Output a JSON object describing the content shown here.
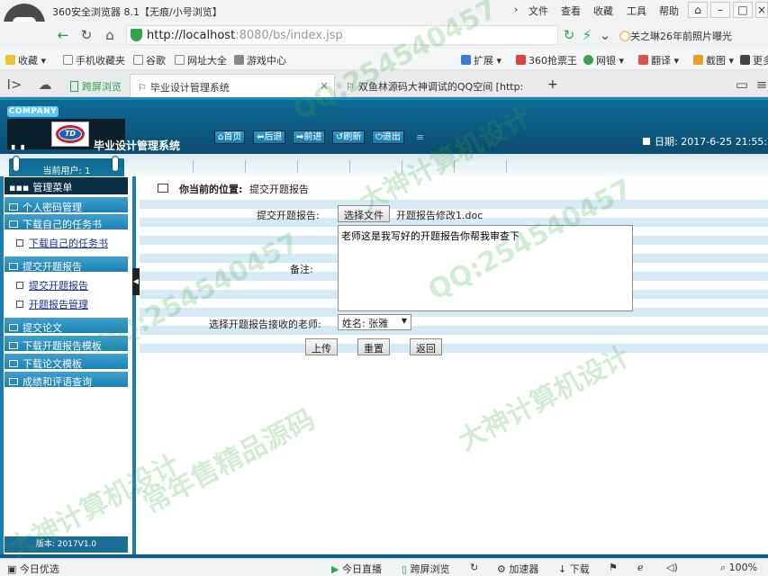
{
  "browser": {
    "title": "360安全浏览器 8.1【无痕/小号浏览】",
    "menu": [
      "文件",
      "查看",
      "收藏",
      "工具",
      "帮助"
    ],
    "url_host": "http://localhost",
    "url_rest": ":8080/bs/index.jsp",
    "search_hint": "关之琳26年前照片曝光",
    "bookmarks": [
      "收藏",
      "手机收藏夹",
      "谷歌",
      "网址大全",
      "游戏中心"
    ],
    "bookmarks_right": [
      "扩展",
      "360抢票王",
      "网银",
      "翻译",
      "截图",
      "更多"
    ],
    "tabs": [
      "跨屏浏览",
      "毕业设计管理系统",
      "双鱼林源码大神调试的QQ空间 [http:"
    ],
    "status_items": [
      "今日优选",
      "今日直播",
      "跨屏浏览",
      "加速器",
      "下载",
      "100%"
    ]
  },
  "header": {
    "company": "COMPANY",
    "logo_text": "TD",
    "system_name": "毕业设计管理系统",
    "buttons": [
      "首页",
      "后退",
      "前进",
      "刷新",
      "退出"
    ],
    "date_label": "日期: 2017-6-25 21:55:27"
  },
  "sidebar": {
    "current_user": "当前用户: 1",
    "menu_title": "管理菜单",
    "groups": [
      {
        "label": "个人密码管理"
      },
      {
        "label": "下载自己的任务书"
      },
      {
        "label": "提交开题报告"
      },
      {
        "label": "提交论文"
      },
      {
        "label": "下载开题报告模板"
      },
      {
        "label": "下载论文模板"
      },
      {
        "label": "成绩和评语查询"
      }
    ],
    "subitems": [
      "下载自己的任务书",
      "提交开题报告",
      "开题报告管理"
    ],
    "version": "版本: 2017V1.0"
  },
  "main": {
    "position_label": "你当前的位置:",
    "position_value": "提交开题报告",
    "file_label": "提交开题报告:",
    "file_button": "选择文件",
    "file_name": "开题报告修改1.doc",
    "remark_label": "备注:",
    "remark_value": "老师这是我写好的开题报告你帮我审查下",
    "teacher_label": "选择开题报告接收的老师:",
    "teacher_value": "姓名: 张雅",
    "submit": "上传",
    "reset": "重置",
    "back": "返回"
  },
  "watermarks": [
    "QQ:254540457",
    "大神计算机设计",
    "常年售精品源码"
  ]
}
